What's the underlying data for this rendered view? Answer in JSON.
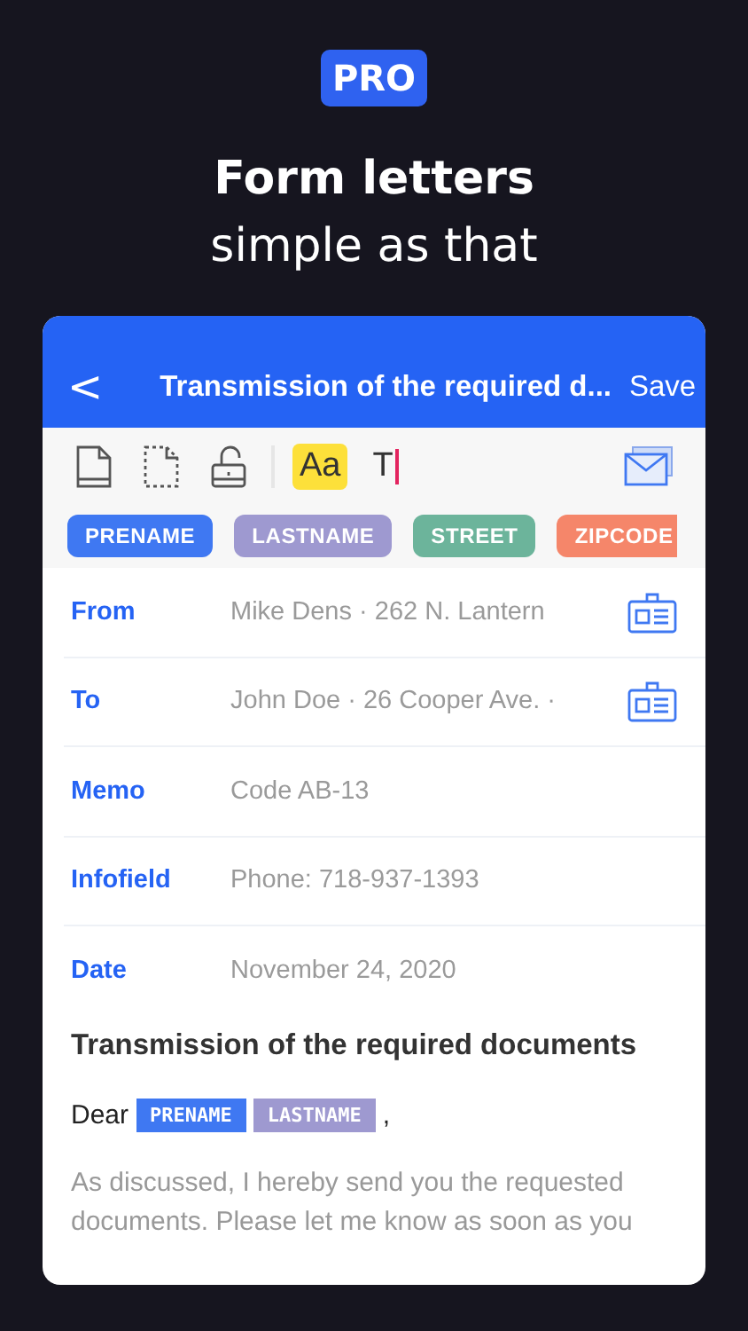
{
  "badge": "PRO",
  "headline": "Form letters",
  "subheadline": "simple as that",
  "nav": {
    "back": "<",
    "title": "Transmission of the required d...",
    "action": "Save"
  },
  "toolbar": [
    {
      "kind": "page",
      "selected": false
    },
    {
      "kind": "dashed-page",
      "selected": false
    },
    {
      "kind": "unlock",
      "selected": false
    },
    {
      "kind": "divider"
    },
    {
      "kind": "font",
      "label": "Aa",
      "selected": true
    },
    {
      "kind": "text-cursor",
      "label": "T",
      "selected": false
    },
    {
      "kind": "envelopes",
      "selected": false
    }
  ],
  "placeholders": [
    {
      "label": "PRENAME",
      "color": "#3f78f2"
    },
    {
      "label": "LASTNAME",
      "color": "#9e99d0"
    },
    {
      "label": "STREET",
      "color": "#6cb49b"
    },
    {
      "label": "ZIPCODE",
      "color": "#f5866a"
    }
  ],
  "fields": [
    {
      "kind": "contact",
      "label": "From",
      "value": "Mike Dens · 262 N. Lantern"
    },
    {
      "kind": "contact",
      "label": "To",
      "value": "John Doe · 26 Cooper Ave. ·"
    },
    {
      "kind": "plain",
      "label": "Memo",
      "value": "Code AB-13"
    },
    {
      "kind": "plain",
      "label": "Infofield",
      "value": "Phone: 718-937-1393"
    },
    {
      "kind": "plain",
      "label": "Date",
      "value": "November 24, 2020"
    }
  ],
  "letter": {
    "subject": "Transmission of the required documents",
    "salutation": [
      {
        "kind": "text",
        "text": "Dear"
      },
      {
        "kind": "field",
        "text": "PRENAME",
        "color": "#3f78f2"
      },
      {
        "kind": "field",
        "text": "LASTNAME",
        "color": "#9e99d0"
      },
      {
        "kind": "text",
        "text": ","
      }
    ],
    "body": "As discussed, I hereby send you the requested documents. Please let me know as soon as you"
  }
}
